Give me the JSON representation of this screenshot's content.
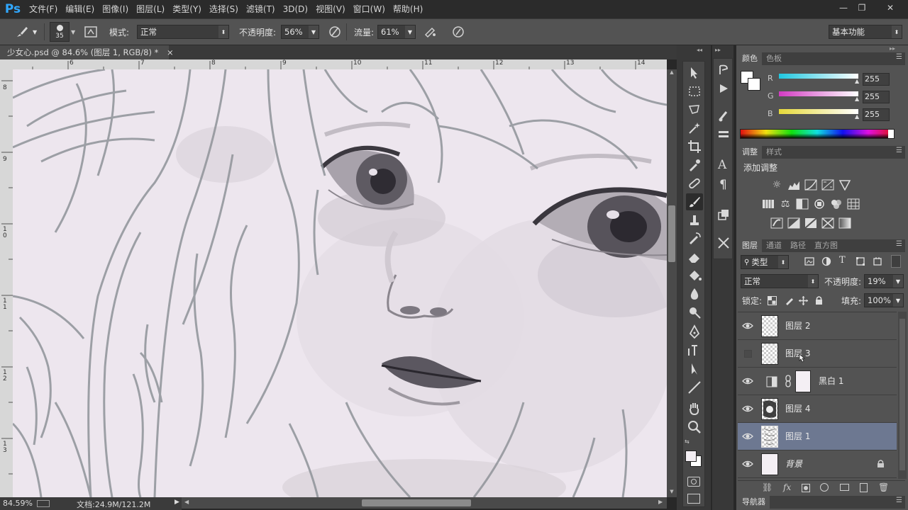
{
  "app": {
    "logo": "Ps"
  },
  "menu": [
    "文件(F)",
    "编辑(E)",
    "图像(I)",
    "图层(L)",
    "类型(Y)",
    "选择(S)",
    "滤镜(T)",
    "3D(D)",
    "视图(V)",
    "窗口(W)",
    "帮助(H)"
  ],
  "window_controls": {
    "minimize": "—",
    "restore": "❐",
    "close": "✕"
  },
  "options": {
    "brush_size": "35",
    "mode_label": "模式:",
    "mode_value": "正常",
    "opacity_label": "不透明度:",
    "opacity_value": "56%",
    "flow_label": "流量:",
    "flow_value": "61%",
    "workspace": "基本功能"
  },
  "document": {
    "tab_title": "少女心.psd @ 84.6% (图层 1, RGB/8) *",
    "close": "×",
    "ruler_top": [
      "6",
      "7",
      "8",
      "9",
      "10",
      "11",
      "12",
      "13",
      "14"
    ],
    "ruler_left": [
      "8",
      "9",
      "1\n0",
      "1\n1",
      "1\n2",
      "1\n3"
    ]
  },
  "status": {
    "zoom": "84.59%",
    "doc_info": "文档:24.9M/121.2M"
  },
  "color_panel": {
    "tabs": [
      "颜色",
      "色板"
    ],
    "channels": [
      {
        "label": "R",
        "value": "255",
        "color": "#1fc7e0"
      },
      {
        "label": "G",
        "value": "255",
        "color": "#d23bc2"
      },
      {
        "label": "B",
        "value": "255",
        "color": "#e6d93a"
      }
    ]
  },
  "adjust_panel": {
    "tabs": [
      "调整",
      "样式"
    ],
    "title": "添加调整"
  },
  "layers_panel": {
    "tabs": [
      "图层",
      "通道",
      "路径",
      "直方图"
    ],
    "filter_label": "类型",
    "blend_mode": "正常",
    "opacity_label": "不透明度:",
    "opacity_value": "19%",
    "lock_label": "锁定:",
    "fill_label": "填充:",
    "fill_value": "100%",
    "layers": [
      {
        "name": "图层 2",
        "visible": true,
        "selected": false
      },
      {
        "name": "图层 3",
        "visible": false,
        "selected": false
      },
      {
        "name": "黑白 1",
        "visible": true,
        "selected": false
      },
      {
        "name": "图层 4",
        "visible": true,
        "selected": false
      },
      {
        "name": "图层 1",
        "visible": true,
        "selected": true
      },
      {
        "name": "背景",
        "visible": true,
        "selected": false
      }
    ]
  },
  "navigator": {
    "label": "导航器"
  }
}
